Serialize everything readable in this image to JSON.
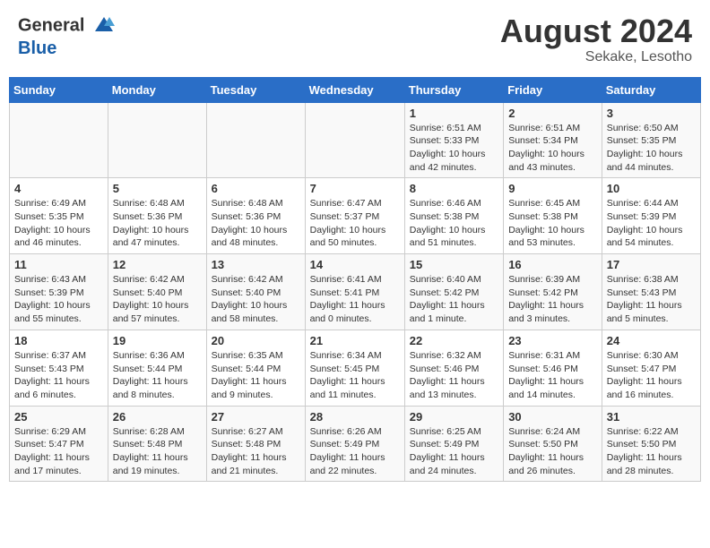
{
  "header": {
    "logo": {
      "line1": "General",
      "line2": "Blue"
    },
    "title": "August 2024",
    "subtitle": "Sekake, Lesotho"
  },
  "weekdays": [
    "Sunday",
    "Monday",
    "Tuesday",
    "Wednesday",
    "Thursday",
    "Friday",
    "Saturday"
  ],
  "weeks": [
    [
      {
        "day": "",
        "info": ""
      },
      {
        "day": "",
        "info": ""
      },
      {
        "day": "",
        "info": ""
      },
      {
        "day": "",
        "info": ""
      },
      {
        "day": "1",
        "info": "Sunrise: 6:51 AM\nSunset: 5:33 PM\nDaylight: 10 hours\nand 42 minutes."
      },
      {
        "day": "2",
        "info": "Sunrise: 6:51 AM\nSunset: 5:34 PM\nDaylight: 10 hours\nand 43 minutes."
      },
      {
        "day": "3",
        "info": "Sunrise: 6:50 AM\nSunset: 5:35 PM\nDaylight: 10 hours\nand 44 minutes."
      }
    ],
    [
      {
        "day": "4",
        "info": "Sunrise: 6:49 AM\nSunset: 5:35 PM\nDaylight: 10 hours\nand 46 minutes."
      },
      {
        "day": "5",
        "info": "Sunrise: 6:48 AM\nSunset: 5:36 PM\nDaylight: 10 hours\nand 47 minutes."
      },
      {
        "day": "6",
        "info": "Sunrise: 6:48 AM\nSunset: 5:36 PM\nDaylight: 10 hours\nand 48 minutes."
      },
      {
        "day": "7",
        "info": "Sunrise: 6:47 AM\nSunset: 5:37 PM\nDaylight: 10 hours\nand 50 minutes."
      },
      {
        "day": "8",
        "info": "Sunrise: 6:46 AM\nSunset: 5:38 PM\nDaylight: 10 hours\nand 51 minutes."
      },
      {
        "day": "9",
        "info": "Sunrise: 6:45 AM\nSunset: 5:38 PM\nDaylight: 10 hours\nand 53 minutes."
      },
      {
        "day": "10",
        "info": "Sunrise: 6:44 AM\nSunset: 5:39 PM\nDaylight: 10 hours\nand 54 minutes."
      }
    ],
    [
      {
        "day": "11",
        "info": "Sunrise: 6:43 AM\nSunset: 5:39 PM\nDaylight: 10 hours\nand 55 minutes."
      },
      {
        "day": "12",
        "info": "Sunrise: 6:42 AM\nSunset: 5:40 PM\nDaylight: 10 hours\nand 57 minutes."
      },
      {
        "day": "13",
        "info": "Sunrise: 6:42 AM\nSunset: 5:40 PM\nDaylight: 10 hours\nand 58 minutes."
      },
      {
        "day": "14",
        "info": "Sunrise: 6:41 AM\nSunset: 5:41 PM\nDaylight: 11 hours\nand 0 minutes."
      },
      {
        "day": "15",
        "info": "Sunrise: 6:40 AM\nSunset: 5:42 PM\nDaylight: 11 hours\nand 1 minute."
      },
      {
        "day": "16",
        "info": "Sunrise: 6:39 AM\nSunset: 5:42 PM\nDaylight: 11 hours\nand 3 minutes."
      },
      {
        "day": "17",
        "info": "Sunrise: 6:38 AM\nSunset: 5:43 PM\nDaylight: 11 hours\nand 5 minutes."
      }
    ],
    [
      {
        "day": "18",
        "info": "Sunrise: 6:37 AM\nSunset: 5:43 PM\nDaylight: 11 hours\nand 6 minutes."
      },
      {
        "day": "19",
        "info": "Sunrise: 6:36 AM\nSunset: 5:44 PM\nDaylight: 11 hours\nand 8 minutes."
      },
      {
        "day": "20",
        "info": "Sunrise: 6:35 AM\nSunset: 5:44 PM\nDaylight: 11 hours\nand 9 minutes."
      },
      {
        "day": "21",
        "info": "Sunrise: 6:34 AM\nSunset: 5:45 PM\nDaylight: 11 hours\nand 11 minutes."
      },
      {
        "day": "22",
        "info": "Sunrise: 6:32 AM\nSunset: 5:46 PM\nDaylight: 11 hours\nand 13 minutes."
      },
      {
        "day": "23",
        "info": "Sunrise: 6:31 AM\nSunset: 5:46 PM\nDaylight: 11 hours\nand 14 minutes."
      },
      {
        "day": "24",
        "info": "Sunrise: 6:30 AM\nSunset: 5:47 PM\nDaylight: 11 hours\nand 16 minutes."
      }
    ],
    [
      {
        "day": "25",
        "info": "Sunrise: 6:29 AM\nSunset: 5:47 PM\nDaylight: 11 hours\nand 17 minutes."
      },
      {
        "day": "26",
        "info": "Sunrise: 6:28 AM\nSunset: 5:48 PM\nDaylight: 11 hours\nand 19 minutes."
      },
      {
        "day": "27",
        "info": "Sunrise: 6:27 AM\nSunset: 5:48 PM\nDaylight: 11 hours\nand 21 minutes."
      },
      {
        "day": "28",
        "info": "Sunrise: 6:26 AM\nSunset: 5:49 PM\nDaylight: 11 hours\nand 22 minutes."
      },
      {
        "day": "29",
        "info": "Sunrise: 6:25 AM\nSunset: 5:49 PM\nDaylight: 11 hours\nand 24 minutes."
      },
      {
        "day": "30",
        "info": "Sunrise: 6:24 AM\nSunset: 5:50 PM\nDaylight: 11 hours\nand 26 minutes."
      },
      {
        "day": "31",
        "info": "Sunrise: 6:22 AM\nSunset: 5:50 PM\nDaylight: 11 hours\nand 28 minutes."
      }
    ]
  ]
}
